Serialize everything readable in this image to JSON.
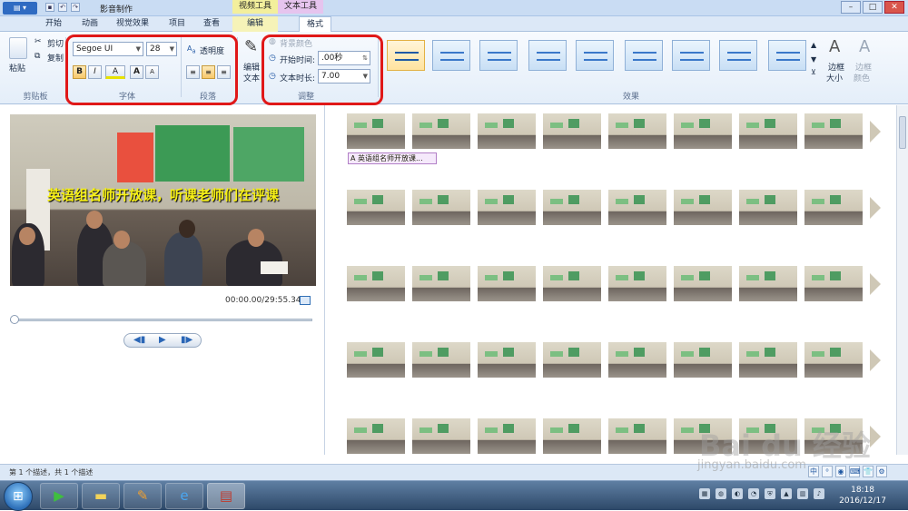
{
  "window": {
    "title": "影音制作",
    "context_tabs": {
      "video_tools": "视频工具",
      "text_tools": "文本工具"
    },
    "buttons": {
      "min": "–",
      "max": "□",
      "close": "✕"
    }
  },
  "tabs": [
    "开始",
    "动画",
    "视觉效果",
    "项目",
    "查看",
    "编辑",
    "格式"
  ],
  "active_tab": "格式",
  "ribbon": {
    "clipboard": {
      "paste": "粘贴",
      "cut": "剪切",
      "copy": "复制",
      "group": "剪贴板"
    },
    "font": {
      "family": "Segoe UI",
      "size": "28",
      "bold": "B",
      "italic": "I",
      "color": "A",
      "grow": "A",
      "shrink": "A",
      "group": "字体"
    },
    "paragraph": {
      "transparency": "透明度",
      "group": "段落"
    },
    "adjust": {
      "edit_text": "编辑",
      "edit_text2": "文本",
      "bg_color": "背景颜色",
      "start_time_label": "开始时间:",
      "start_time_value": ".00秒",
      "duration_label": "文本时长:",
      "duration_value": "7.00",
      "group": "调整"
    },
    "effects": {
      "group": "效果",
      "border_size": "边框",
      "border_size2": "大小",
      "border_color": "边框",
      "border_color2": "颜色"
    }
  },
  "preview": {
    "caption": "英语组名师开放课，听课老师们在评课",
    "time": "00:00.00/29:55.34"
  },
  "storyboard": {
    "text_clip_label": "英语组名师开放课..."
  },
  "status": {
    "text": "第 1 个描述，共 1 个描述"
  },
  "watermark": {
    "logo": "Bai du 经验",
    "sub": "jingyan.baidu.com"
  },
  "ime": [
    "中",
    "⁰",
    "◉",
    "⌨",
    "👕",
    "⚙"
  ],
  "taskbar": {
    "clock_time": "18:18",
    "clock_date": "2016/12/17"
  }
}
